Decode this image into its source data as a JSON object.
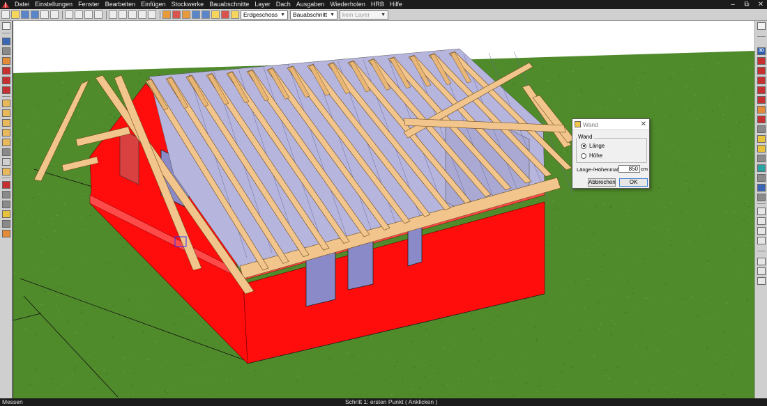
{
  "menu": [
    "Datei",
    "Einstellungen",
    "Fenster",
    "Bearbeiten",
    "Einfügen",
    "Stockwerke",
    "Bauabschnitte",
    "Layer",
    "Dach",
    "Ausgaben",
    "Wiederholen",
    "HRB",
    "Hilfe"
  ],
  "window_controls": {
    "minimize": "–",
    "restore": "⧉",
    "close": "✕"
  },
  "toolbar": {
    "floor_select": "Erdgeschoss",
    "section_select": "Bauabschnitt",
    "layer_select": "kein Layer"
  },
  "right_toolbar": {
    "view_3d_label": "3D"
  },
  "dialog": {
    "title": "Wand",
    "group_label": "Wand",
    "option_length": "Länge",
    "option_height": "Höhe",
    "selected_option": "Länge",
    "measure_label": "Länge-/Höhenmaß:",
    "measure_value": "850",
    "measure_unit": "cm",
    "cancel_label": "Abbrechen",
    "ok_label": "OK"
  },
  "status": {
    "left": "Messen",
    "center": "Schritt 1: ersten Punkt ( Anklicken )"
  },
  "colors": {
    "sky": "#ffffff",
    "grass": "#4f8a2b",
    "wall": "#ff0c0c",
    "timber": "#f2c58c",
    "ceiling": "#b5b5de"
  }
}
